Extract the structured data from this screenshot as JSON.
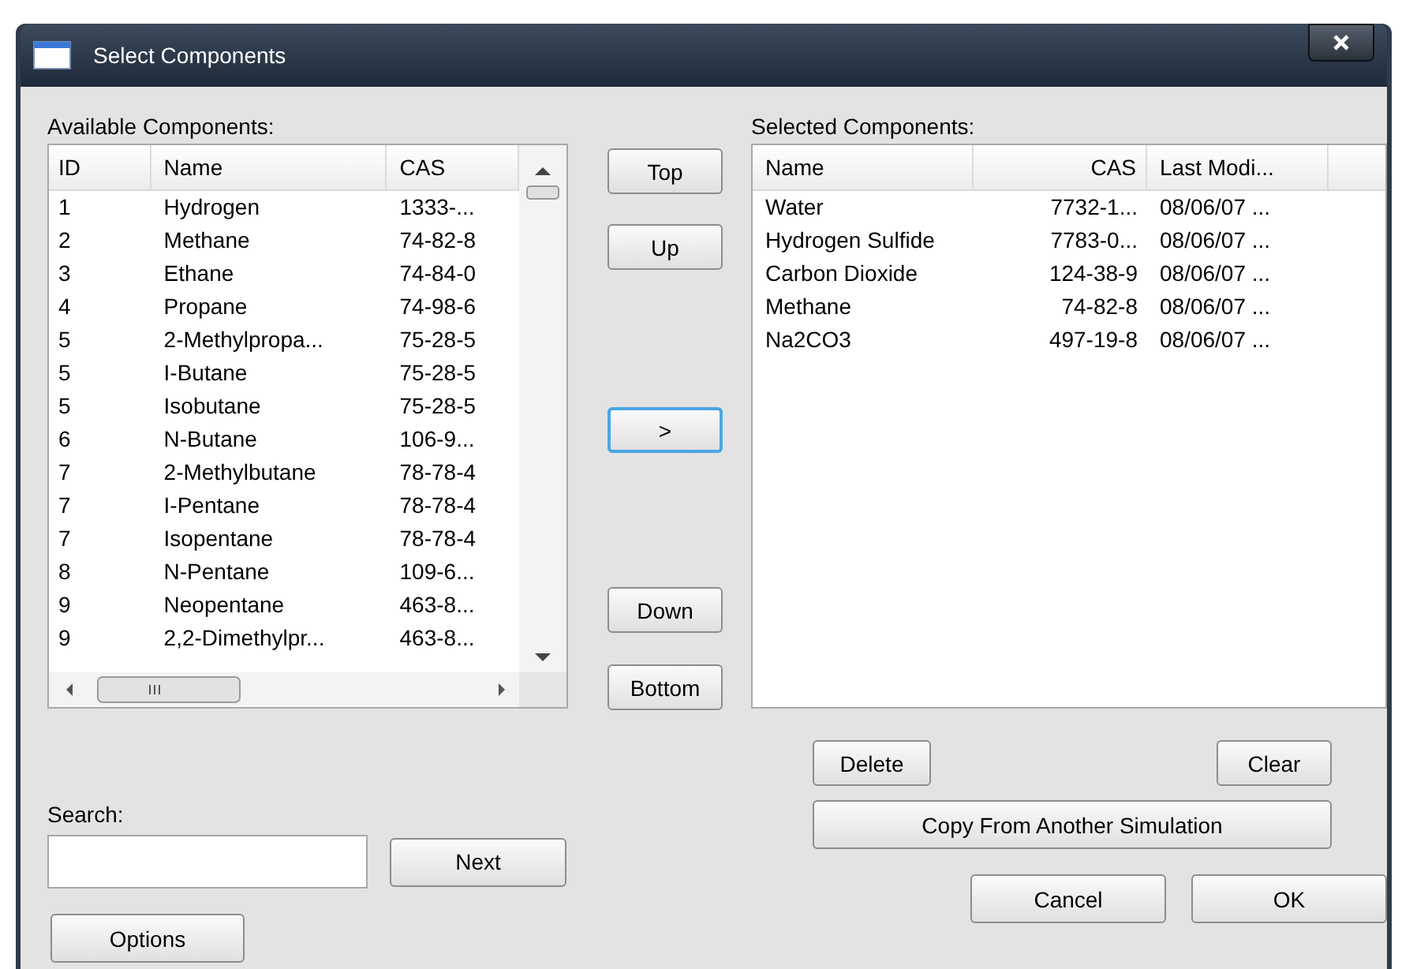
{
  "window": {
    "title": "Select Components"
  },
  "available": {
    "label": "Available Components:",
    "columns": [
      "ID",
      "Name",
      "CAS"
    ],
    "rows": [
      {
        "id": "1",
        "name": "Hydrogen",
        "cas": "1333-..."
      },
      {
        "id": "2",
        "name": "Methane",
        "cas": "74-82-8"
      },
      {
        "id": "3",
        "name": "Ethane",
        "cas": "74-84-0"
      },
      {
        "id": "4",
        "name": "Propane",
        "cas": "74-98-6"
      },
      {
        "id": "5",
        "name": "2-Methylpropa...",
        "cas": "75-28-5"
      },
      {
        "id": "5",
        "name": "I-Butane",
        "cas": "75-28-5"
      },
      {
        "id": "5",
        "name": "Isobutane",
        "cas": "75-28-5"
      },
      {
        "id": "6",
        "name": "N-Butane",
        "cas": "106-9..."
      },
      {
        "id": "7",
        "name": "2-Methylbutane",
        "cas": "78-78-4"
      },
      {
        "id": "7",
        "name": "I-Pentane",
        "cas": "78-78-4"
      },
      {
        "id": "7",
        "name": "Isopentane",
        "cas": "78-78-4"
      },
      {
        "id": "8",
        "name": "N-Pentane",
        "cas": "109-6..."
      },
      {
        "id": "9",
        "name": "Neopentane",
        "cas": "463-8..."
      },
      {
        "id": "9",
        "name": "2,2-Dimethylpr...",
        "cas": "463-8..."
      }
    ]
  },
  "move_buttons": [
    {
      "label": "Top",
      "focused": false
    },
    {
      "label": "Up",
      "focused": false
    },
    {
      "label": ">",
      "focused": true
    },
    {
      "label": "Down",
      "focused": false
    },
    {
      "label": "Bottom",
      "focused": false
    }
  ],
  "selected": {
    "label": "Selected Components:",
    "columns": [
      "Name",
      "CAS",
      "Last Modi..."
    ],
    "rows": [
      {
        "name": "Water",
        "cas": "7732-1...",
        "modified": "08/06/07 ..."
      },
      {
        "name": "Hydrogen Sulfide",
        "cas": "7783-0...",
        "modified": "08/06/07 ..."
      },
      {
        "name": "Carbon Dioxide",
        "cas": "124-38-9",
        "modified": "08/06/07 ..."
      },
      {
        "name": "Methane",
        "cas": "74-82-8",
        "modified": "08/06/07 ..."
      },
      {
        "name": "Na2CO3",
        "cas": "497-19-8",
        "modified": "08/06/07 ..."
      }
    ]
  },
  "search": {
    "label": "Search:",
    "next": "Next"
  },
  "options": "Options",
  "delete": "Delete",
  "clear": "Clear",
  "copy": "Copy From Another Simulation",
  "cancel": "Cancel",
  "ok": "OK"
}
